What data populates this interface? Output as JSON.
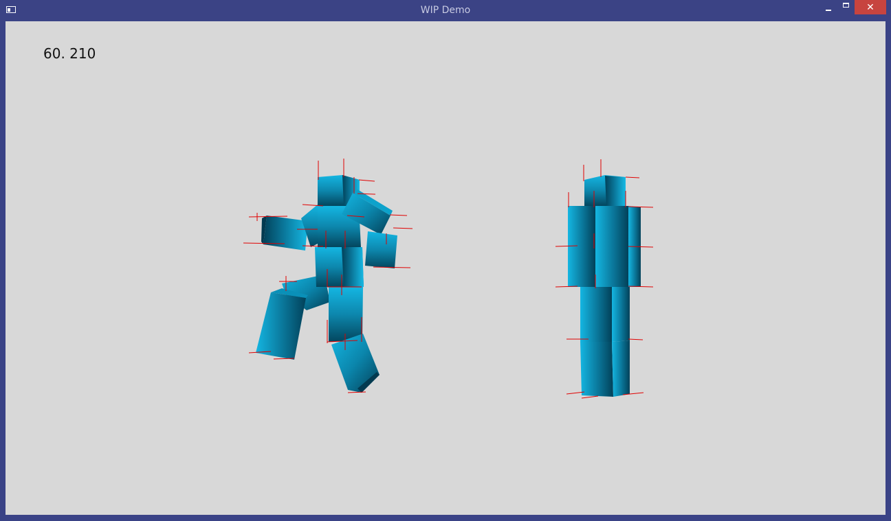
{
  "window": {
    "title": "WIP Demo",
    "close_glyph": "✕"
  },
  "hud": {
    "fps_readout": "60. 210"
  },
  "scene": {
    "figures": [
      "ragdoll-posed",
      "ragdoll-standing"
    ],
    "colors": {
      "cube_light": "#14b6e2",
      "cube_dark": "#034259",
      "axis_line": "#e00000",
      "background": "#d8d8d8",
      "frame": "#3b4385",
      "close_button": "#c7443f"
    }
  }
}
